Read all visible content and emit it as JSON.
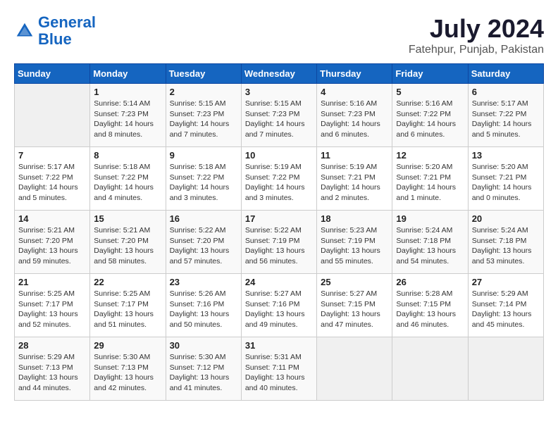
{
  "header": {
    "logo_line1": "General",
    "logo_line2": "Blue",
    "month_year": "July 2024",
    "location": "Fatehpur, Punjab, Pakistan"
  },
  "weekdays": [
    "Sunday",
    "Monday",
    "Tuesday",
    "Wednesday",
    "Thursday",
    "Friday",
    "Saturday"
  ],
  "weeks": [
    [
      {
        "day": "",
        "info": ""
      },
      {
        "day": "1",
        "info": "Sunrise: 5:14 AM\nSunset: 7:23 PM\nDaylight: 14 hours\nand 8 minutes."
      },
      {
        "day": "2",
        "info": "Sunrise: 5:15 AM\nSunset: 7:23 PM\nDaylight: 14 hours\nand 7 minutes."
      },
      {
        "day": "3",
        "info": "Sunrise: 5:15 AM\nSunset: 7:23 PM\nDaylight: 14 hours\nand 7 minutes."
      },
      {
        "day": "4",
        "info": "Sunrise: 5:16 AM\nSunset: 7:23 PM\nDaylight: 14 hours\nand 6 minutes."
      },
      {
        "day": "5",
        "info": "Sunrise: 5:16 AM\nSunset: 7:22 PM\nDaylight: 14 hours\nand 6 minutes."
      },
      {
        "day": "6",
        "info": "Sunrise: 5:17 AM\nSunset: 7:22 PM\nDaylight: 14 hours\nand 5 minutes."
      }
    ],
    [
      {
        "day": "7",
        "info": "Sunrise: 5:17 AM\nSunset: 7:22 PM\nDaylight: 14 hours\nand 5 minutes."
      },
      {
        "day": "8",
        "info": "Sunrise: 5:18 AM\nSunset: 7:22 PM\nDaylight: 14 hours\nand 4 minutes."
      },
      {
        "day": "9",
        "info": "Sunrise: 5:18 AM\nSunset: 7:22 PM\nDaylight: 14 hours\nand 3 minutes."
      },
      {
        "day": "10",
        "info": "Sunrise: 5:19 AM\nSunset: 7:22 PM\nDaylight: 14 hours\nand 3 minutes."
      },
      {
        "day": "11",
        "info": "Sunrise: 5:19 AM\nSunset: 7:21 PM\nDaylight: 14 hours\nand 2 minutes."
      },
      {
        "day": "12",
        "info": "Sunrise: 5:20 AM\nSunset: 7:21 PM\nDaylight: 14 hours\nand 1 minute."
      },
      {
        "day": "13",
        "info": "Sunrise: 5:20 AM\nSunset: 7:21 PM\nDaylight: 14 hours\nand 0 minutes."
      }
    ],
    [
      {
        "day": "14",
        "info": "Sunrise: 5:21 AM\nSunset: 7:20 PM\nDaylight: 13 hours\nand 59 minutes."
      },
      {
        "day": "15",
        "info": "Sunrise: 5:21 AM\nSunset: 7:20 PM\nDaylight: 13 hours\nand 58 minutes."
      },
      {
        "day": "16",
        "info": "Sunrise: 5:22 AM\nSunset: 7:20 PM\nDaylight: 13 hours\nand 57 minutes."
      },
      {
        "day": "17",
        "info": "Sunrise: 5:22 AM\nSunset: 7:19 PM\nDaylight: 13 hours\nand 56 minutes."
      },
      {
        "day": "18",
        "info": "Sunrise: 5:23 AM\nSunset: 7:19 PM\nDaylight: 13 hours\nand 55 minutes."
      },
      {
        "day": "19",
        "info": "Sunrise: 5:24 AM\nSunset: 7:18 PM\nDaylight: 13 hours\nand 54 minutes."
      },
      {
        "day": "20",
        "info": "Sunrise: 5:24 AM\nSunset: 7:18 PM\nDaylight: 13 hours\nand 53 minutes."
      }
    ],
    [
      {
        "day": "21",
        "info": "Sunrise: 5:25 AM\nSunset: 7:17 PM\nDaylight: 13 hours\nand 52 minutes."
      },
      {
        "day": "22",
        "info": "Sunrise: 5:25 AM\nSunset: 7:17 PM\nDaylight: 13 hours\nand 51 minutes."
      },
      {
        "day": "23",
        "info": "Sunrise: 5:26 AM\nSunset: 7:16 PM\nDaylight: 13 hours\nand 50 minutes."
      },
      {
        "day": "24",
        "info": "Sunrise: 5:27 AM\nSunset: 7:16 PM\nDaylight: 13 hours\nand 49 minutes."
      },
      {
        "day": "25",
        "info": "Sunrise: 5:27 AM\nSunset: 7:15 PM\nDaylight: 13 hours\nand 47 minutes."
      },
      {
        "day": "26",
        "info": "Sunrise: 5:28 AM\nSunset: 7:15 PM\nDaylight: 13 hours\nand 46 minutes."
      },
      {
        "day": "27",
        "info": "Sunrise: 5:29 AM\nSunset: 7:14 PM\nDaylight: 13 hours\nand 45 minutes."
      }
    ],
    [
      {
        "day": "28",
        "info": "Sunrise: 5:29 AM\nSunset: 7:13 PM\nDaylight: 13 hours\nand 44 minutes."
      },
      {
        "day": "29",
        "info": "Sunrise: 5:30 AM\nSunset: 7:13 PM\nDaylight: 13 hours\nand 42 minutes."
      },
      {
        "day": "30",
        "info": "Sunrise: 5:30 AM\nSunset: 7:12 PM\nDaylight: 13 hours\nand 41 minutes."
      },
      {
        "day": "31",
        "info": "Sunrise: 5:31 AM\nSunset: 7:11 PM\nDaylight: 13 hours\nand 40 minutes."
      },
      {
        "day": "",
        "info": ""
      },
      {
        "day": "",
        "info": ""
      },
      {
        "day": "",
        "info": ""
      }
    ]
  ]
}
